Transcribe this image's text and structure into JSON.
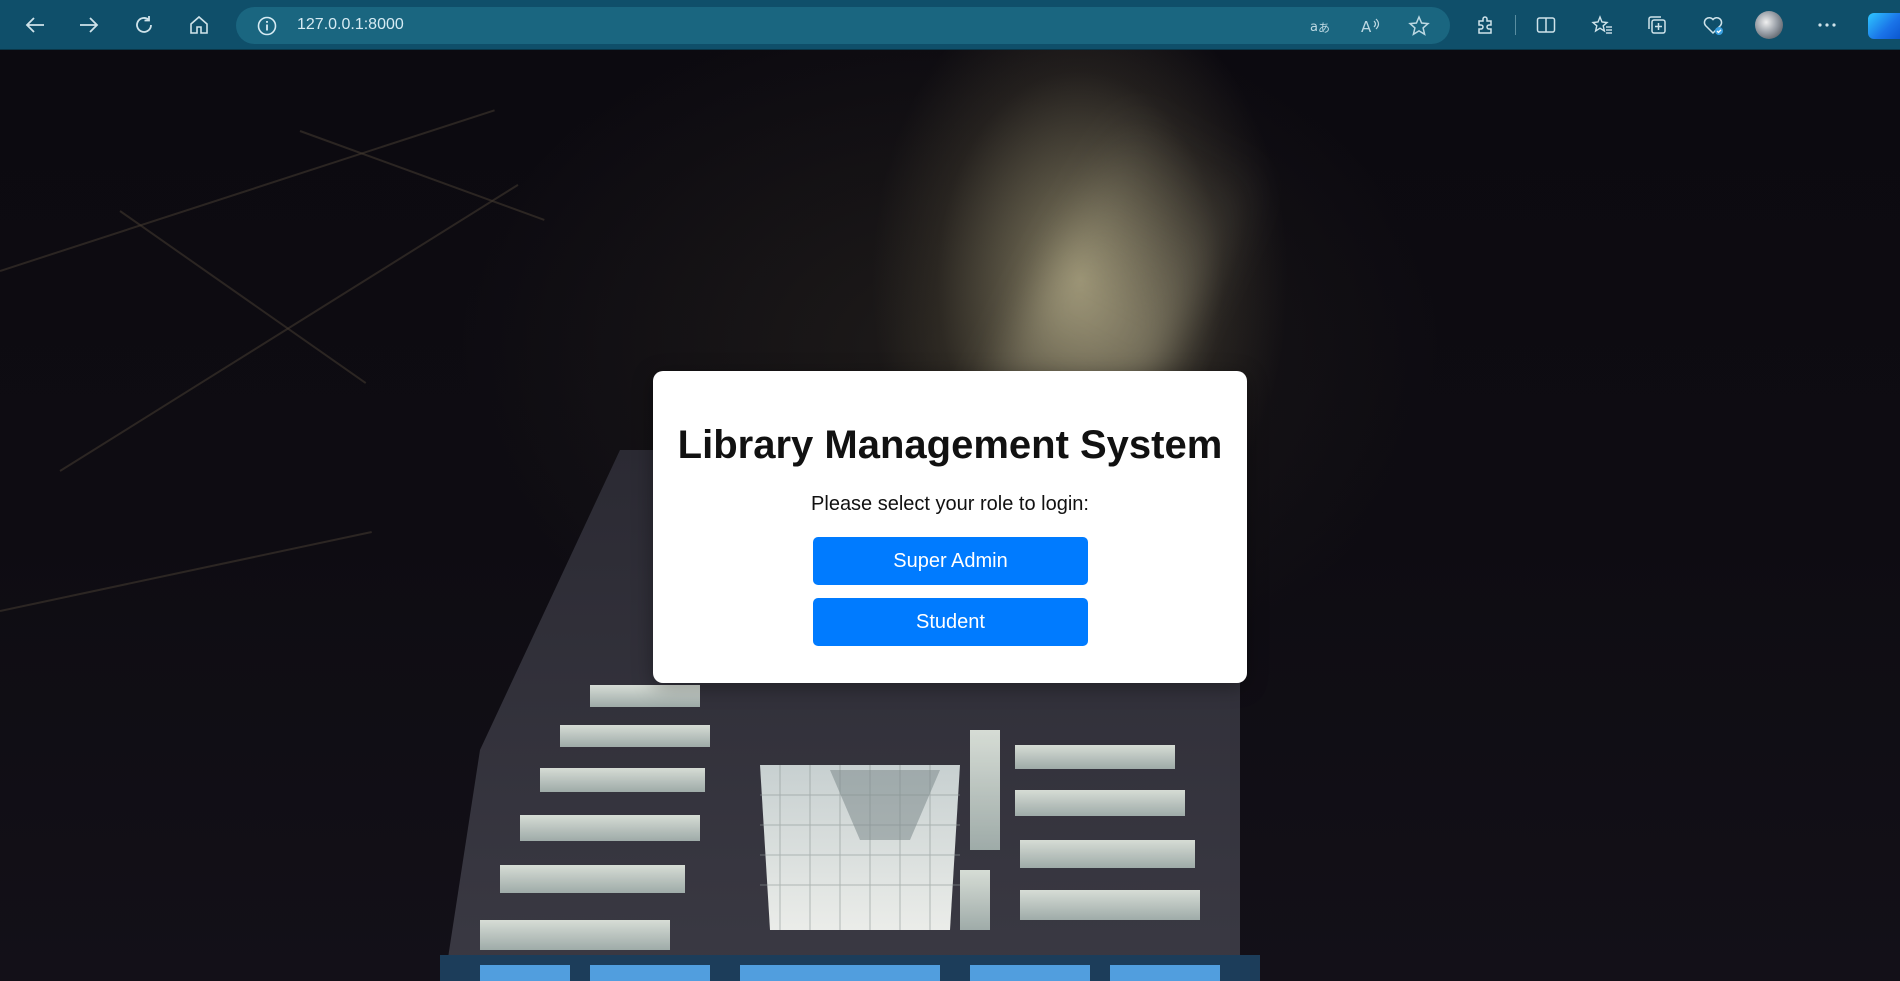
{
  "browser": {
    "url": "127.0.0.1:8000",
    "toolbar_icons": [
      "back-icon",
      "forward-icon",
      "refresh-icon",
      "home-icon",
      "site-info-icon",
      "translate-icon",
      "read-aloud-icon",
      "favorite-star-icon",
      "extensions-icon",
      "split-screen-icon",
      "favorites-icon",
      "collections-icon",
      "browser-essentials-icon",
      "profile-avatar",
      "more-menu-icon",
      "copilot-icon"
    ]
  },
  "page": {
    "title": "Library Management System",
    "prompt": "Please select your role to login:",
    "buttons": {
      "super_admin": "Super Admin",
      "student": "Student"
    },
    "colors": {
      "button": "#007bff",
      "card": "#ffffff",
      "toolbar": "#0f4f6a"
    }
  }
}
